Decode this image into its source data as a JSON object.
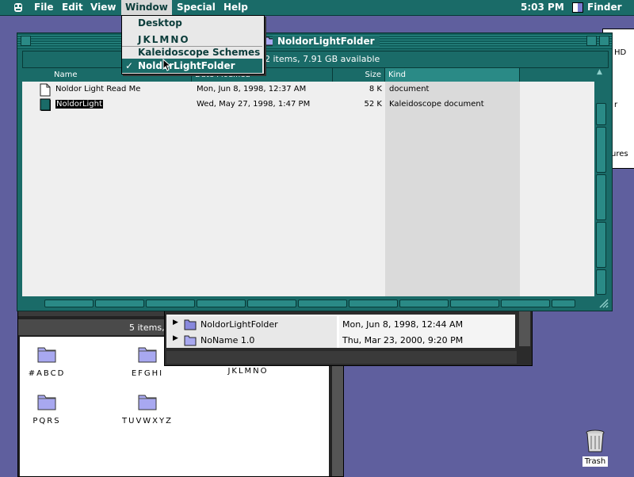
{
  "menubar": {
    "items": [
      "File",
      "Edit",
      "View",
      "Window",
      "Special",
      "Help"
    ],
    "clock": "5:03 PM",
    "app": "Finder"
  },
  "window_menu": {
    "items": [
      "Desktop",
      "JKLMNO",
      "Kaleidoscope Schemes",
      "NoldorLightFolder"
    ],
    "checked": "✓"
  },
  "main_window": {
    "title": "NoldorLightFolder",
    "info": "2 items, 7.91 GB available",
    "columns": [
      "Name",
      "Date Modified",
      "Size",
      "Kind"
    ],
    "files": [
      {
        "name": "Noldor Light Read Me",
        "date": "Mon, Jun 8, 1998, 12:37 AM",
        "size": "8 K",
        "kind": "document"
      },
      {
        "name": "NoldorLight",
        "date": "Wed, May 27, 1998, 1:47 PM",
        "size": "52 K",
        "kind": "Kaleidoscope document"
      }
    ]
  },
  "back_window_icons": {
    "info": "5 items,",
    "folders": [
      "#ABCD",
      "EFGHI",
      "JKLMNO",
      "PQRS",
      "TUVWXYZ"
    ]
  },
  "back_window_list": {
    "rows": [
      {
        "name": "NoldorLightFolder",
        "date": "Mon, Jun 8, 1998, 12:44 AM"
      },
      {
        "name": "NoName 1.0",
        "date": "Thu, Mar 23, 2000, 9:20 PM"
      }
    ]
  },
  "edge_labels": [
    "HD",
    "r",
    "ures"
  ],
  "trash": {
    "label": "Trash"
  },
  "colors": {
    "accent": "#1a6b68",
    "desktop": "#5f5f9e"
  }
}
